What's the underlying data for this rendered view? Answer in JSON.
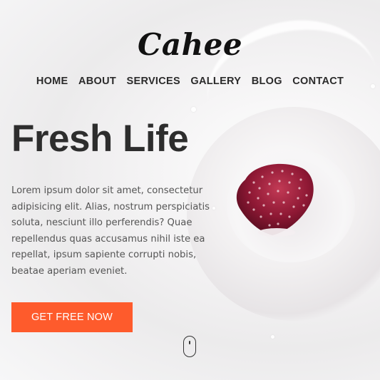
{
  "brand": {
    "logo_text": "Cahee"
  },
  "nav": {
    "items": [
      {
        "label": "HOME"
      },
      {
        "label": "ABOUT"
      },
      {
        "label": "SERVICES"
      },
      {
        "label": "GALLERY"
      },
      {
        "label": "BLOG"
      },
      {
        "label": "CONTACT"
      }
    ]
  },
  "hero": {
    "headline": "Fresh Life",
    "body": "Lorem ipsum dolor sit amet, consectetur adipisicing elit. Alias, nostrum perspiciatis soluta, nesciunt illo perferendis? Quae repellendus quas accusamus nihil iste ea repellat, ipsum sapiente corrupti nobis, beataе aperiam eveniet.",
    "cta_label": "GET FREE NOW"
  },
  "colors": {
    "accent": "#fe5b2c",
    "text_dark": "#2d2d2d",
    "text_body": "#555555"
  },
  "icons": {
    "scroll": "mouse-scroll-icon",
    "hero_image": "strawberry-milk-splash-image"
  }
}
